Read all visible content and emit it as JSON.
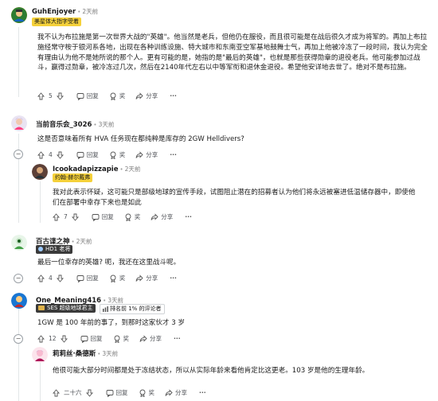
{
  "comments": [
    {
      "author": "GuhEnjoyer",
      "time": "2天前",
      "flair": "美星体大指字受着",
      "text": "我不认为布拉施是第一次世界大战的\"英雄\"。他当然是老兵，但他仍在服役，而且很可能是在战后很久才成为将军的。再加上布拉施经常守桉于银河系各地，出现在各种训练设施、特大城市和东南亚空军基地鼓舞士气，再加上他被冷冻了一段时间，我认为完全有理由认为他不是她所说的那个人。更有可能的是，她指的是\"最后的英雄\"，也就是那些获得勋章的退役老兵。他可能参加过战斗，赢得过勋章，被冷冻过几次，然后在2140年代左右以中等军衔和退休金退役。希望他安详地去世了。绝对不是布拉施。",
      "votes": "5",
      "reply": "回复",
      "award": "奖",
      "share": "分享"
    },
    {
      "author": "当前音乐会_3026",
      "time": "3天前",
      "text": "这是否意味着所有 HVA 任务现在都纯粹是库存的 2GW Helldivers?",
      "votes": "4",
      "reply": "回复",
      "award": "奖",
      "share": "分享"
    },
    {
      "author": "Icookadapizzapie",
      "time": "2天前",
      "flair": "约翰·赫尔戴弗",
      "text": "我对此表示怀疑，这可能只是部级地球的宣传手段，试图阻止潜在的招募者认为他们将永远被塞进低温储存器中，即使他们在部署中幸存下来也是如此",
      "votes": "7",
      "reply": "回复",
      "award": "奖",
      "share": "分享"
    },
    {
      "author": "百古谍之神",
      "time": "2天前",
      "flair": "HD1 老将",
      "text": "最后一位幸存的英雄? 呃，我还在这里战斗呢。",
      "votes": "4",
      "reply": "回复",
      "award": "奖",
      "share": "分享"
    },
    {
      "author": "One_Meaning416",
      "time": "3天前",
      "flair": "SES 超级地球君主",
      "badge": "排名前 1% 的评论者",
      "text": "1GW 是 100 年前的事了，到那时这家伙才 3 岁",
      "votes": "12",
      "reply": "回复",
      "award": "奖",
      "share": "分享"
    },
    {
      "author": "莉莉丝·桑德斯",
      "time": "3天前",
      "text": "他很可能大部分时间都是处于冻结状态，所以从实际年龄来看他肯定比这更老。103 岁是他的生理年龄。",
      "votes": "二十六",
      "reply": "回复",
      "award": "奖",
      "share": "分享"
    }
  ],
  "colors": {
    "flair_yellow": "#f5d13a",
    "flair_dark": "#3a3a3a",
    "thread_line": "#e3e6e8",
    "link": "#1a1a1b"
  }
}
